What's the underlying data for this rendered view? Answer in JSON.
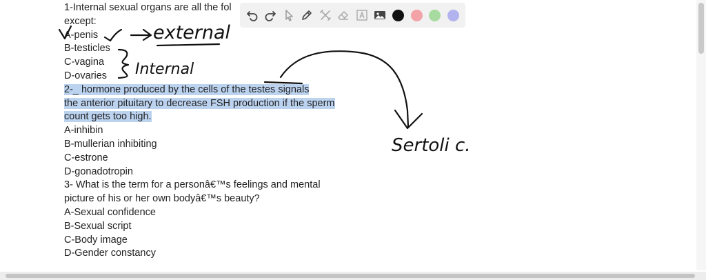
{
  "document": {
    "lines": [
      "1-Internal sexual organs are all the fol",
      "except:",
      "A-penis",
      "B-testicles",
      "C-vagina",
      "D-ovaries",
      "2-_ hormone produced by the cells of the testes signals",
      "the anterior pituitary to decrease FSH production if the sperm",
      "count gets too high.",
      "A-inhibin",
      "B-mullerian inhibiting",
      "C-estrone",
      "D-gonadotropin",
      "3- What is the term for a personâ€™s feelings and mental",
      "picture of his or her own bodyâ€™s beauty?",
      "A-Sexual confidence",
      "B-Sexual script",
      "C-Body image",
      "D-Gender constancy"
    ]
  },
  "annotations": {
    "external": "external",
    "internal": "Internal",
    "sertoli": "Sertoli c."
  },
  "toolbar": {
    "tools": [
      "undo-icon",
      "redo-icon",
      "pointer-icon",
      "pen-icon",
      "tools-icon",
      "eraser-icon",
      "text-icon",
      "image-icon"
    ],
    "colors": [
      "#111111",
      "#f3a2a8",
      "#a8dba0",
      "#b2b2ee"
    ]
  },
  "highlight_color": "#bcd3f0"
}
